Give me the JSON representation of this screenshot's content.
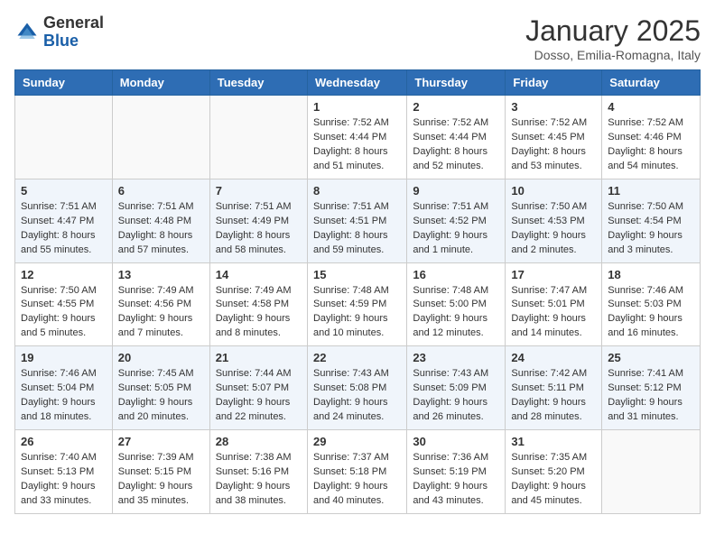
{
  "header": {
    "logo_general": "General",
    "logo_blue": "Blue",
    "month_title": "January 2025",
    "location": "Dosso, Emilia-Romagna, Italy"
  },
  "days_of_week": [
    "Sunday",
    "Monday",
    "Tuesday",
    "Wednesday",
    "Thursday",
    "Friday",
    "Saturday"
  ],
  "weeks": [
    [
      {
        "day": "",
        "info": ""
      },
      {
        "day": "",
        "info": ""
      },
      {
        "day": "",
        "info": ""
      },
      {
        "day": "1",
        "info": "Sunrise: 7:52 AM\nSunset: 4:44 PM\nDaylight: 8 hours and 51 minutes."
      },
      {
        "day": "2",
        "info": "Sunrise: 7:52 AM\nSunset: 4:44 PM\nDaylight: 8 hours and 52 minutes."
      },
      {
        "day": "3",
        "info": "Sunrise: 7:52 AM\nSunset: 4:45 PM\nDaylight: 8 hours and 53 minutes."
      },
      {
        "day": "4",
        "info": "Sunrise: 7:52 AM\nSunset: 4:46 PM\nDaylight: 8 hours and 54 minutes."
      }
    ],
    [
      {
        "day": "5",
        "info": "Sunrise: 7:51 AM\nSunset: 4:47 PM\nDaylight: 8 hours and 55 minutes."
      },
      {
        "day": "6",
        "info": "Sunrise: 7:51 AM\nSunset: 4:48 PM\nDaylight: 8 hours and 57 minutes."
      },
      {
        "day": "7",
        "info": "Sunrise: 7:51 AM\nSunset: 4:49 PM\nDaylight: 8 hours and 58 minutes."
      },
      {
        "day": "8",
        "info": "Sunrise: 7:51 AM\nSunset: 4:51 PM\nDaylight: 8 hours and 59 minutes."
      },
      {
        "day": "9",
        "info": "Sunrise: 7:51 AM\nSunset: 4:52 PM\nDaylight: 9 hours and 1 minute."
      },
      {
        "day": "10",
        "info": "Sunrise: 7:50 AM\nSunset: 4:53 PM\nDaylight: 9 hours and 2 minutes."
      },
      {
        "day": "11",
        "info": "Sunrise: 7:50 AM\nSunset: 4:54 PM\nDaylight: 9 hours and 3 minutes."
      }
    ],
    [
      {
        "day": "12",
        "info": "Sunrise: 7:50 AM\nSunset: 4:55 PM\nDaylight: 9 hours and 5 minutes."
      },
      {
        "day": "13",
        "info": "Sunrise: 7:49 AM\nSunset: 4:56 PM\nDaylight: 9 hours and 7 minutes."
      },
      {
        "day": "14",
        "info": "Sunrise: 7:49 AM\nSunset: 4:58 PM\nDaylight: 9 hours and 8 minutes."
      },
      {
        "day": "15",
        "info": "Sunrise: 7:48 AM\nSunset: 4:59 PM\nDaylight: 9 hours and 10 minutes."
      },
      {
        "day": "16",
        "info": "Sunrise: 7:48 AM\nSunset: 5:00 PM\nDaylight: 9 hours and 12 minutes."
      },
      {
        "day": "17",
        "info": "Sunrise: 7:47 AM\nSunset: 5:01 PM\nDaylight: 9 hours and 14 minutes."
      },
      {
        "day": "18",
        "info": "Sunrise: 7:46 AM\nSunset: 5:03 PM\nDaylight: 9 hours and 16 minutes."
      }
    ],
    [
      {
        "day": "19",
        "info": "Sunrise: 7:46 AM\nSunset: 5:04 PM\nDaylight: 9 hours and 18 minutes."
      },
      {
        "day": "20",
        "info": "Sunrise: 7:45 AM\nSunset: 5:05 PM\nDaylight: 9 hours and 20 minutes."
      },
      {
        "day": "21",
        "info": "Sunrise: 7:44 AM\nSunset: 5:07 PM\nDaylight: 9 hours and 22 minutes."
      },
      {
        "day": "22",
        "info": "Sunrise: 7:43 AM\nSunset: 5:08 PM\nDaylight: 9 hours and 24 minutes."
      },
      {
        "day": "23",
        "info": "Sunrise: 7:43 AM\nSunset: 5:09 PM\nDaylight: 9 hours and 26 minutes."
      },
      {
        "day": "24",
        "info": "Sunrise: 7:42 AM\nSunset: 5:11 PM\nDaylight: 9 hours and 28 minutes."
      },
      {
        "day": "25",
        "info": "Sunrise: 7:41 AM\nSunset: 5:12 PM\nDaylight: 9 hours and 31 minutes."
      }
    ],
    [
      {
        "day": "26",
        "info": "Sunrise: 7:40 AM\nSunset: 5:13 PM\nDaylight: 9 hours and 33 minutes."
      },
      {
        "day": "27",
        "info": "Sunrise: 7:39 AM\nSunset: 5:15 PM\nDaylight: 9 hours and 35 minutes."
      },
      {
        "day": "28",
        "info": "Sunrise: 7:38 AM\nSunset: 5:16 PM\nDaylight: 9 hours and 38 minutes."
      },
      {
        "day": "29",
        "info": "Sunrise: 7:37 AM\nSunset: 5:18 PM\nDaylight: 9 hours and 40 minutes."
      },
      {
        "day": "30",
        "info": "Sunrise: 7:36 AM\nSunset: 5:19 PM\nDaylight: 9 hours and 43 minutes."
      },
      {
        "day": "31",
        "info": "Sunrise: 7:35 AM\nSunset: 5:20 PM\nDaylight: 9 hours and 45 minutes."
      },
      {
        "day": "",
        "info": ""
      }
    ]
  ]
}
